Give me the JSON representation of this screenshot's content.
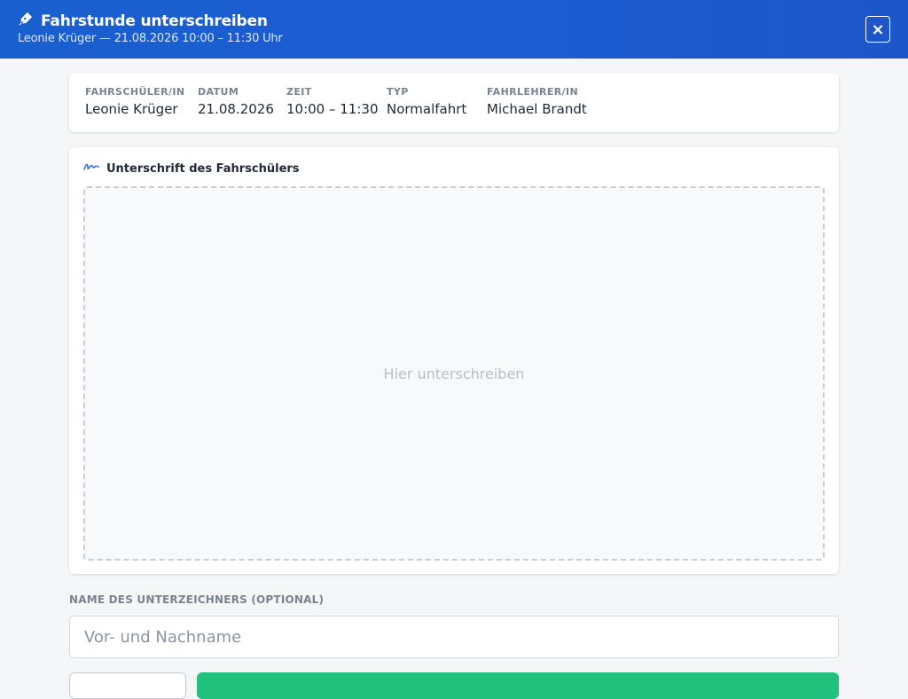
{
  "header": {
    "title": "Fahrstunde unterschreiben",
    "subtitle": "Leonie Krüger — 21.08.2026 10:00 – 11:30 Uhr",
    "close_label": "×",
    "color_from": "#1a5fd0",
    "color_to": "#1d56c9"
  },
  "info": {
    "student_label": "Fahrschüler/in",
    "student_value": "Leonie Krüger",
    "date_label": "Datum",
    "date_value": "21.08.2026",
    "time_label": "Zeit",
    "time_value": "10:00 – 11:30",
    "type_label": "Typ",
    "type_value": "Normalfahrt",
    "instructor_label": "Fahrlehrer/in",
    "instructor_value": "Michael Brandt"
  },
  "signature": {
    "heading": "Unterschrift des Fahrschülers",
    "placeholder": "Hier unterschreiben",
    "icon": "signature-icon"
  },
  "signer": {
    "label": "NAME DES UNTERZEICHNERS (OPTIONAL)",
    "placeholder": "Vor- und Nachname",
    "value": ""
  },
  "actions": {
    "secondary_label": "",
    "primary_label": "",
    "primary_color": "#22c27e"
  }
}
